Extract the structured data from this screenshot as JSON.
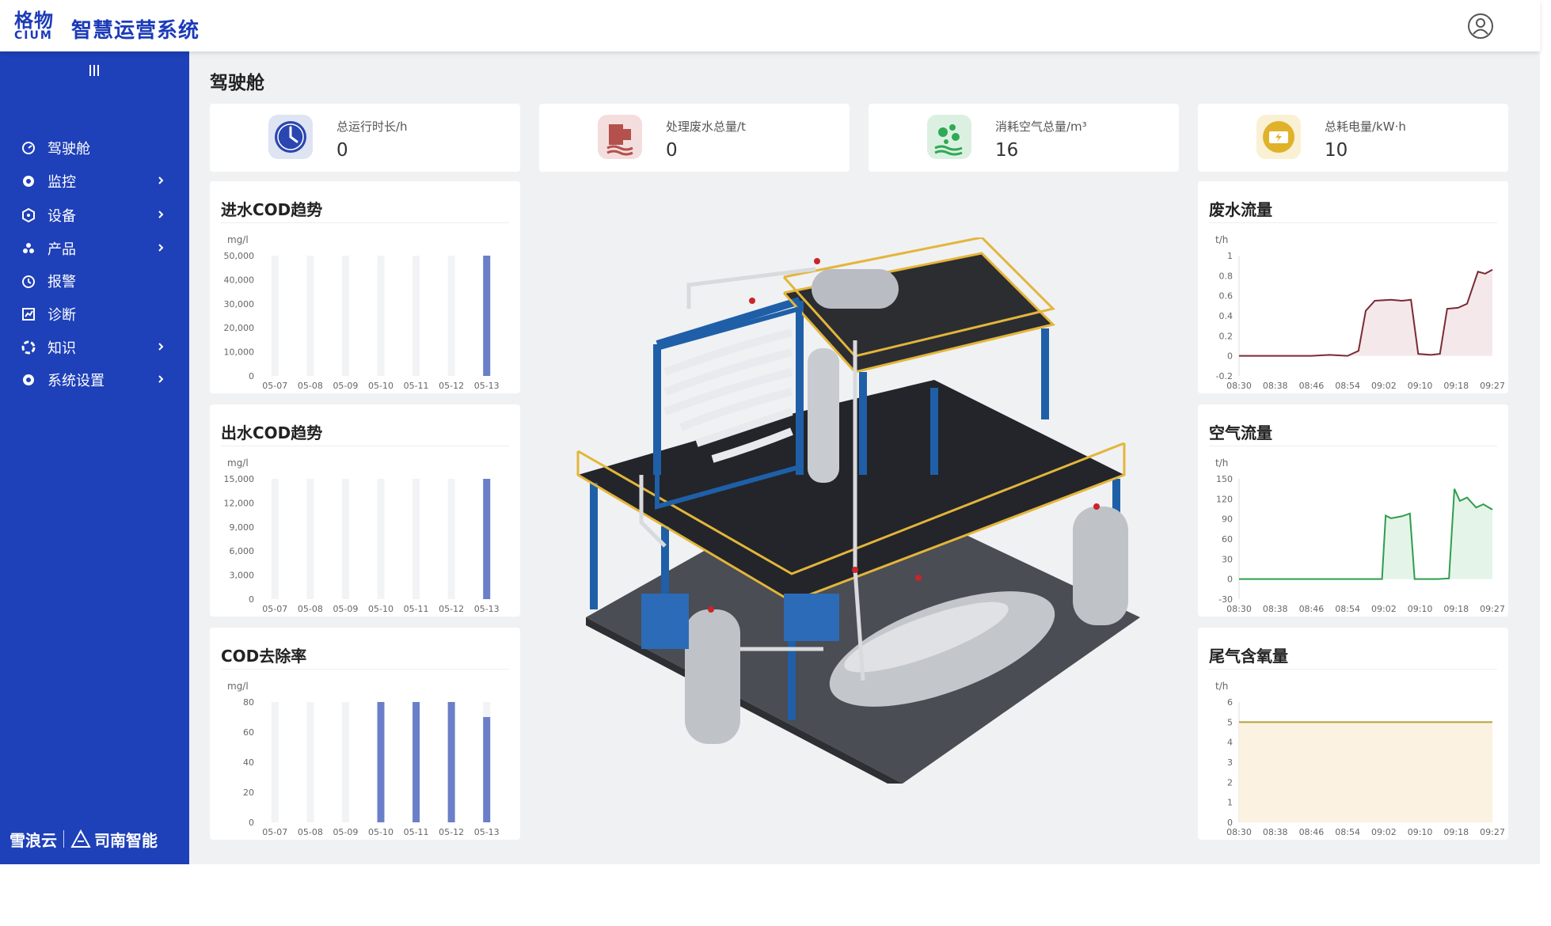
{
  "header": {
    "logo_cn": "格物",
    "logo_en": "CIUM",
    "title": "智慧运营系统"
  },
  "sidebar": {
    "items": [
      {
        "label": "驾驶舱",
        "icon": "dashboard-icon",
        "has_children": false
      },
      {
        "label": "监控",
        "icon": "monitor-icon",
        "has_children": true
      },
      {
        "label": "设备",
        "icon": "device-icon",
        "has_children": true
      },
      {
        "label": "产品",
        "icon": "product-icon",
        "has_children": true
      },
      {
        "label": "报警",
        "icon": "alarm-icon",
        "has_children": false
      },
      {
        "label": "诊断",
        "icon": "diagnosis-icon",
        "has_children": false
      },
      {
        "label": "知识",
        "icon": "knowledge-icon",
        "has_children": true
      },
      {
        "label": "系统设置",
        "icon": "settings-icon",
        "has_children": true
      }
    ],
    "footer_brand_1": "雪浪云",
    "footer_brand_2": "司南智能"
  },
  "page": {
    "title": "驾驶舱"
  },
  "stats": [
    {
      "label": "总运行时长/h",
      "value": "0",
      "icon": "clock-icon",
      "color": "#2a46b0"
    },
    {
      "label": "处理废水总量/t",
      "value": "0",
      "icon": "wastewater-icon",
      "color": "#b5514d"
    },
    {
      "label": "消耗空气总量/m³",
      "value": "16",
      "icon": "air-icon",
      "color": "#2eaa55"
    },
    {
      "label": "总耗电量/kW·h",
      "value": "10",
      "icon": "power-icon",
      "color": "#e0b22a"
    }
  ],
  "charts": {
    "inlet_cod": {
      "title": "进水COD趋势",
      "chart_data": {
        "type": "bar",
        "ylabel": "mg/l",
        "categories": [
          "05-07",
          "05-08",
          "05-09",
          "05-10",
          "05-11",
          "05-12",
          "05-13"
        ],
        "values": [
          0,
          0,
          0,
          0,
          0,
          0,
          50000
        ],
        "ylim": [
          0,
          50000
        ],
        "yticks": [
          "0",
          "10,000",
          "20,000",
          "30,000",
          "40,000",
          "50,000"
        ],
        "bar_color": "#6a7fc8",
        "background_bar_color": "#f2f3f5"
      }
    },
    "outlet_cod": {
      "title": "出水COD趋势",
      "chart_data": {
        "type": "bar",
        "ylabel": "mg/l",
        "categories": [
          "05-07",
          "05-08",
          "05-09",
          "05-10",
          "05-11",
          "05-12",
          "05-13"
        ],
        "values": [
          0,
          0,
          0,
          0,
          0,
          0,
          15000
        ],
        "ylim": [
          0,
          15000
        ],
        "yticks": [
          "0",
          "3,000",
          "6,000",
          "9,000",
          "12,000",
          "15,000"
        ],
        "bar_color": "#6a7fc8",
        "background_bar_color": "#f2f3f5"
      }
    },
    "cod_removal": {
      "title": "COD去除率",
      "chart_data": {
        "type": "bar",
        "ylabel": "mg/l",
        "categories": [
          "05-07",
          "05-08",
          "05-09",
          "05-10",
          "05-11",
          "05-12",
          "05-13"
        ],
        "values": [
          0,
          0,
          0,
          80,
          80,
          80,
          70
        ],
        "ylim": [
          0,
          80
        ],
        "yticks": [
          "0",
          "20",
          "40",
          "60",
          "80"
        ],
        "bar_color": "#6a7fc8",
        "background_bar_color": "#f2f3f5"
      }
    },
    "wastewater_flow": {
      "title": "废水流量",
      "chart_data": {
        "type": "area",
        "ylabel": "t/h",
        "xticks": [
          "08:30",
          "08:38",
          "08:46",
          "08:54",
          "09:02",
          "09:10",
          "09:18",
          "09:27"
        ],
        "ylim": [
          -0.2,
          1
        ],
        "yticks": [
          "-0.2",
          "0",
          "0.2",
          "0.4",
          "0.6",
          "0.8",
          "1"
        ],
        "x": [
          0,
          1.0,
          2.0,
          2.5,
          3.0,
          3.3,
          3.5,
          3.75,
          4.2,
          4.5,
          4.75,
          4.95,
          5.3,
          5.55,
          5.75,
          6.05,
          6.3,
          6.6,
          6.8,
          7.0
        ],
        "values": [
          0,
          0,
          0,
          0.01,
          0,
          0.05,
          0.45,
          0.55,
          0.56,
          0.55,
          0.56,
          0.02,
          0.01,
          0.02,
          0.47,
          0.48,
          0.52,
          0.84,
          0.82,
          0.86
        ],
        "line_color": "#7a2a34",
        "fill_color": "#f3e6e8"
      }
    },
    "air_flow": {
      "title": "空气流量",
      "chart_data": {
        "type": "area",
        "ylabel": "t/h",
        "xticks": [
          "08:30",
          "08:38",
          "08:46",
          "08:54",
          "09:02",
          "09:10",
          "09:18",
          "09:27"
        ],
        "ylim": [
          -30,
          150
        ],
        "yticks": [
          "-30",
          "0",
          "30",
          "60",
          "90",
          "120",
          "150"
        ],
        "x": [
          0,
          1.0,
          2.0,
          3.0,
          3.95,
          4.05,
          4.2,
          4.5,
          4.72,
          4.85,
          5.5,
          5.8,
          5.95,
          6.1,
          6.3,
          6.55,
          6.75,
          7.0
        ],
        "values": [
          0,
          0,
          0,
          0,
          0,
          95,
          91,
          94,
          98,
          0,
          0,
          1,
          135,
          117,
          122,
          107,
          112,
          104
        ],
        "line_color": "#2e9e4e",
        "fill_color": "#e2f3e6"
      }
    },
    "exhaust_oxygen": {
      "title": "尾气含氧量",
      "chart_data": {
        "type": "area",
        "ylabel": "t/h",
        "xticks": [
          "08:30",
          "08:38",
          "08:46",
          "08:54",
          "09:02",
          "09:10",
          "09:18",
          "09:27"
        ],
        "ylim": [
          0,
          6
        ],
        "yticks": [
          "0",
          "1",
          "2",
          "3",
          "4",
          "5",
          "6"
        ],
        "x": [
          0,
          7
        ],
        "values": [
          5,
          5
        ],
        "line_color": "#b8a03c",
        "fill_color": "#fbf1de"
      }
    }
  }
}
